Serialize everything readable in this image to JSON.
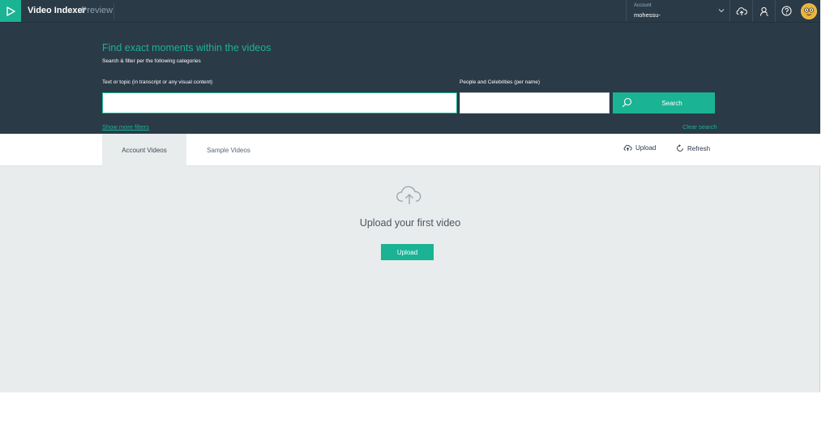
{
  "header": {
    "app_title": "Video Indexer",
    "app_subtitle": "Preview",
    "account": {
      "label": "Account",
      "value": "mohessu-"
    }
  },
  "search": {
    "title": "Find exact moments within the videos",
    "subtitle": "Search & filter per the following categories",
    "text_label": "Text or topic (in transcript or any visual content)",
    "text_value": "",
    "people_label": "People and Celebrities (per name)",
    "people_value": "",
    "button_label": "Search",
    "more_filters": "Show more filters",
    "clear": "Clear search"
  },
  "tabs": [
    {
      "label": "Account Videos",
      "active": true
    },
    {
      "label": "Sample Videos",
      "active": false
    }
  ],
  "actions": {
    "upload": "Upload",
    "refresh": "Refresh"
  },
  "empty_state": {
    "title": "Upload your first video",
    "button": "Upload"
  },
  "colors": {
    "accent": "#1ab394",
    "header_bg": "#2b3a47",
    "content_bg": "#e9eced"
  },
  "icons": [
    "play-icon",
    "chevron-down-icon",
    "cloud-upload-icon",
    "user-icon",
    "help-icon",
    "search-icon",
    "refresh-icon"
  ]
}
